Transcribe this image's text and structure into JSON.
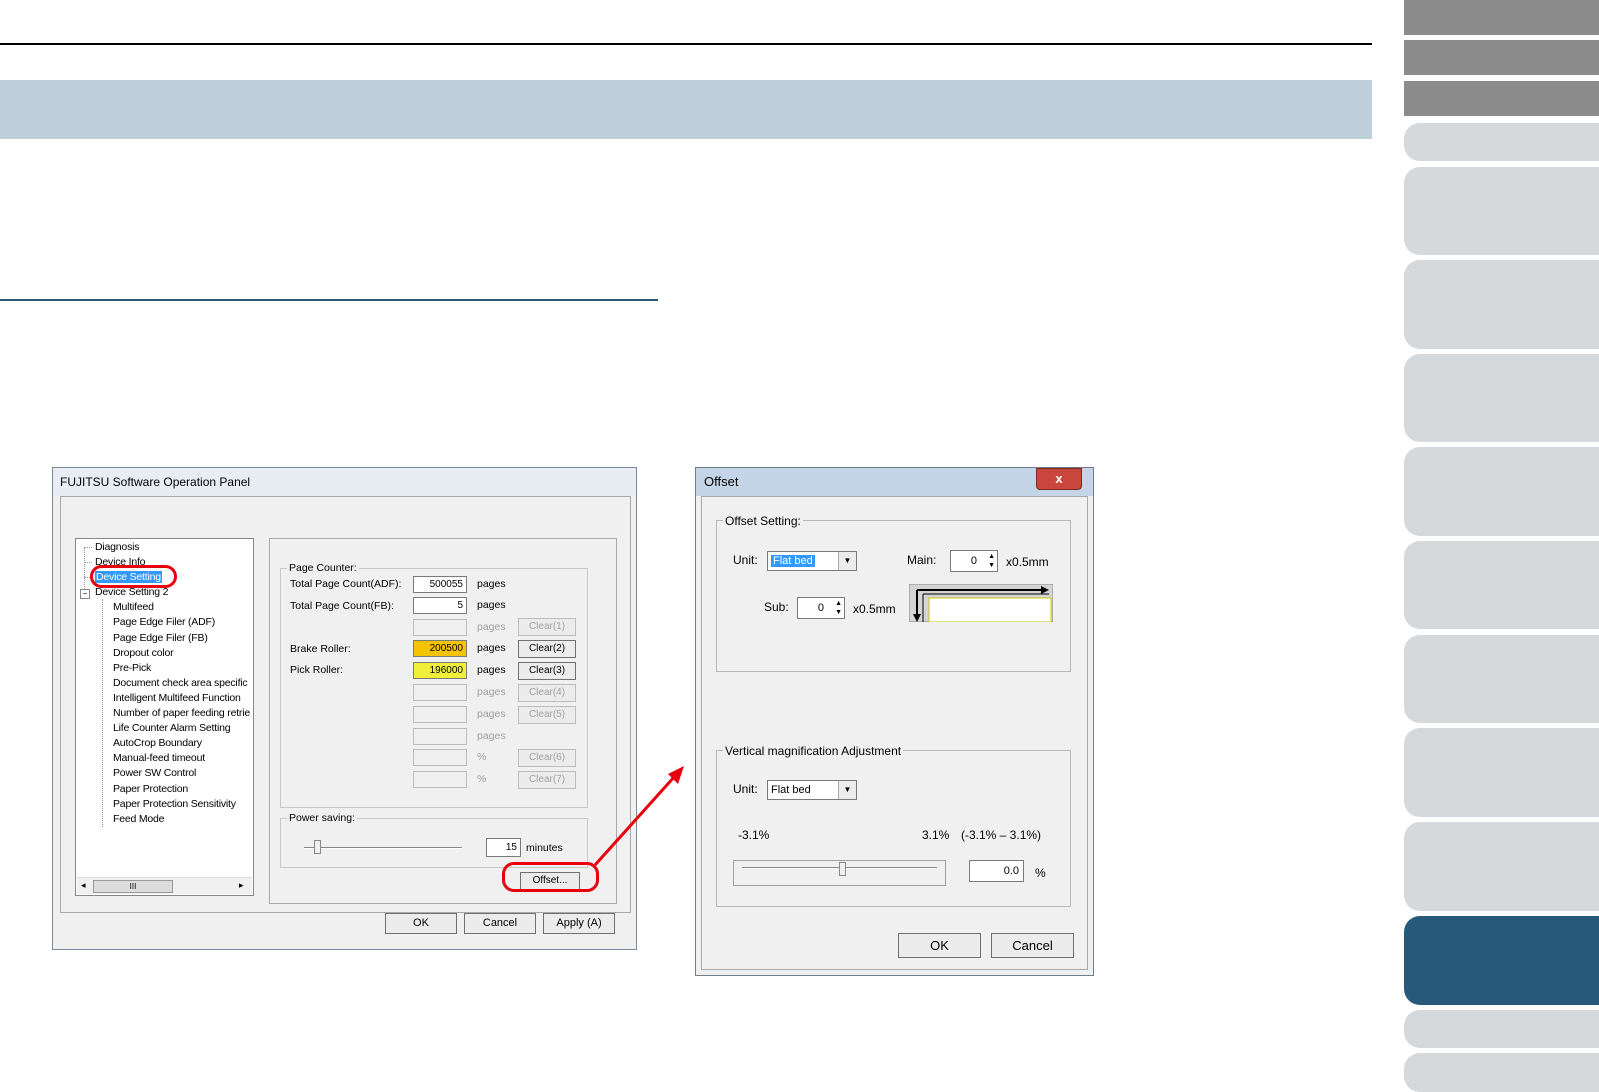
{
  "fuji": {
    "title": "FUJITSU Software Operation Panel",
    "tree": [
      "Diagnosis",
      "Device Info",
      "Device Setting",
      "Device Setting 2",
      "Multifeed",
      "Page Edge Filer (ADF)",
      "Page Edge Filer (FB)",
      "Dropout color",
      "Pre-Pick",
      "Document check area specific",
      "Intelligent Multifeed Function",
      "Number of paper feeding retrie",
      "Life Counter Alarm Setting",
      "AutoCrop Boundary",
      "Manual-feed timeout",
      "Power SW Control",
      "Paper Protection",
      "Paper Protection Sensitivity",
      "Feed Mode"
    ],
    "tree_scroll_thumb": "III",
    "page_counter": {
      "label": "Page Counter:",
      "rows": [
        {
          "label": "Total Page Count(ADF):",
          "value": "500055",
          "unit": "pages",
          "button": ""
        },
        {
          "label": "Total Page Count(FB):",
          "value": "5",
          "unit": "pages",
          "button": ""
        },
        {
          "label": "",
          "value": "",
          "unit": "pages",
          "button": "Clear(1)"
        },
        {
          "label": "Brake Roller:",
          "value": "200500",
          "unit": "pages",
          "button": "Clear(2)"
        },
        {
          "label": "Pick Roller:",
          "value": "196000",
          "unit": "pages",
          "button": "Clear(3)"
        },
        {
          "label": "",
          "value": "",
          "unit": "pages",
          "button": "Clear(4)"
        },
        {
          "label": "",
          "value": "",
          "unit": "pages",
          "button": "Clear(5)"
        },
        {
          "label": "",
          "value": "",
          "unit": "pages",
          "button": ""
        },
        {
          "label": "",
          "value": "",
          "unit": "%",
          "button": "Clear(6)"
        },
        {
          "label": "",
          "value": "",
          "unit": "%",
          "button": "Clear(7)"
        }
      ]
    },
    "power_saving": {
      "label": "Power saving:",
      "value": "15",
      "unit": "minutes"
    },
    "offset_button": "Offset...",
    "ok": "OK",
    "cancel": "Cancel",
    "apply": "Apply (A)"
  },
  "offset": {
    "title": "Offset",
    "close": "x",
    "offset_setting": {
      "label": "Offset Setting:",
      "unit_label": "Unit:",
      "unit_value": "Flat bed",
      "main_label": "Main:",
      "main_value": "0",
      "main_unit": "x0.5mm",
      "sub_label": "Sub:",
      "sub_value": "0",
      "sub_unit": "x0.5mm"
    },
    "vertical": {
      "label": "Vertical magnification Adjustment",
      "unit_label": "Unit:",
      "unit_value": "Flat bed",
      "min": "-3.1%",
      "max": "3.1%",
      "range": "(-3.1% – 3.1%)",
      "value": "0.0",
      "percent": "%"
    },
    "ok": "OK",
    "cancel": "Cancel"
  },
  "colors": {
    "band": "#bfcfd9",
    "active_tab": "#275a7a",
    "callout": "#e8000c"
  }
}
